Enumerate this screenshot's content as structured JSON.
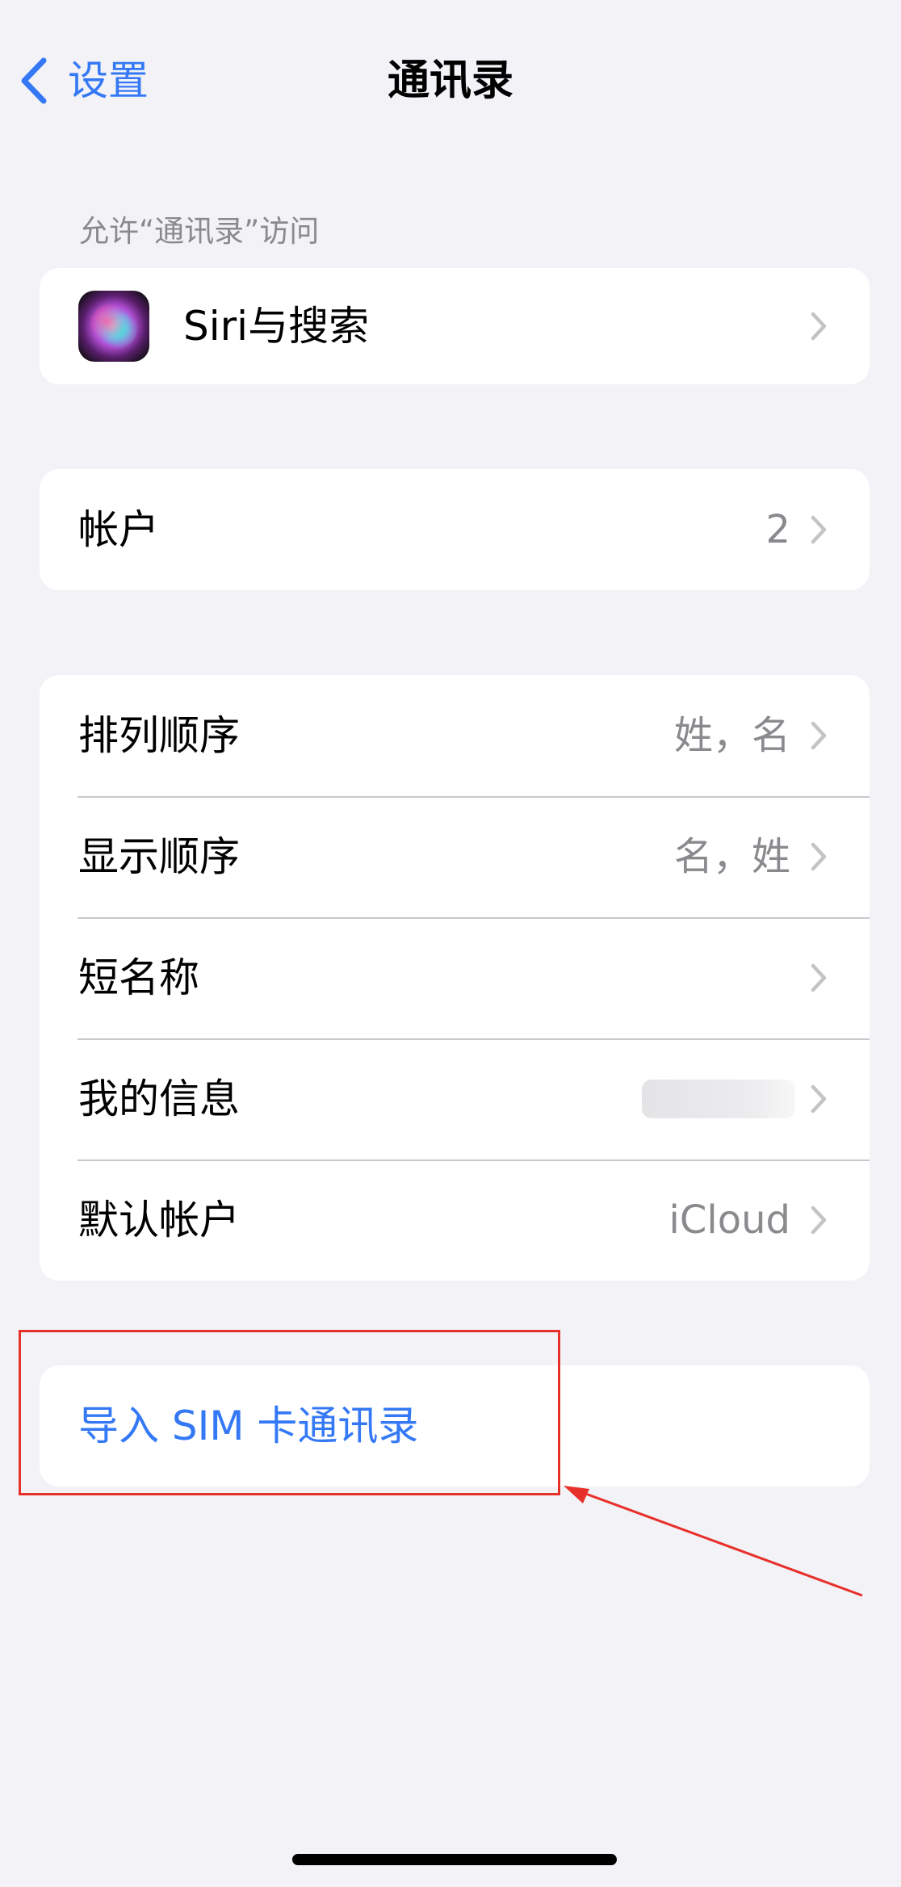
{
  "nav": {
    "back_label": "设置",
    "title": "通讯录"
  },
  "section_header": "允许“通讯录”访问",
  "siri_row": {
    "label": "Siri与搜索",
    "icon": "siri-icon"
  },
  "accounts_row": {
    "label": "帐户",
    "value": "2"
  },
  "settings_rows": [
    {
      "label": "排列顺序",
      "value": "姓，名"
    },
    {
      "label": "显示顺序",
      "value": "名，姓"
    },
    {
      "label": "短名称",
      "value": ""
    },
    {
      "label": "我的信息",
      "value": ""
    },
    {
      "label": "默认帐户",
      "value": "iCloud"
    }
  ],
  "import_row": {
    "label": "导入 SIM 卡通讯录"
  },
  "colors": {
    "background": "#f2f2f7",
    "accent_blue": "#3478f6",
    "secondary_text": "#8a8a8e",
    "annotation_red": "#e8302a"
  },
  "icons": {
    "back": "chevron-left-icon",
    "disclosure": "chevron-right-icon"
  }
}
